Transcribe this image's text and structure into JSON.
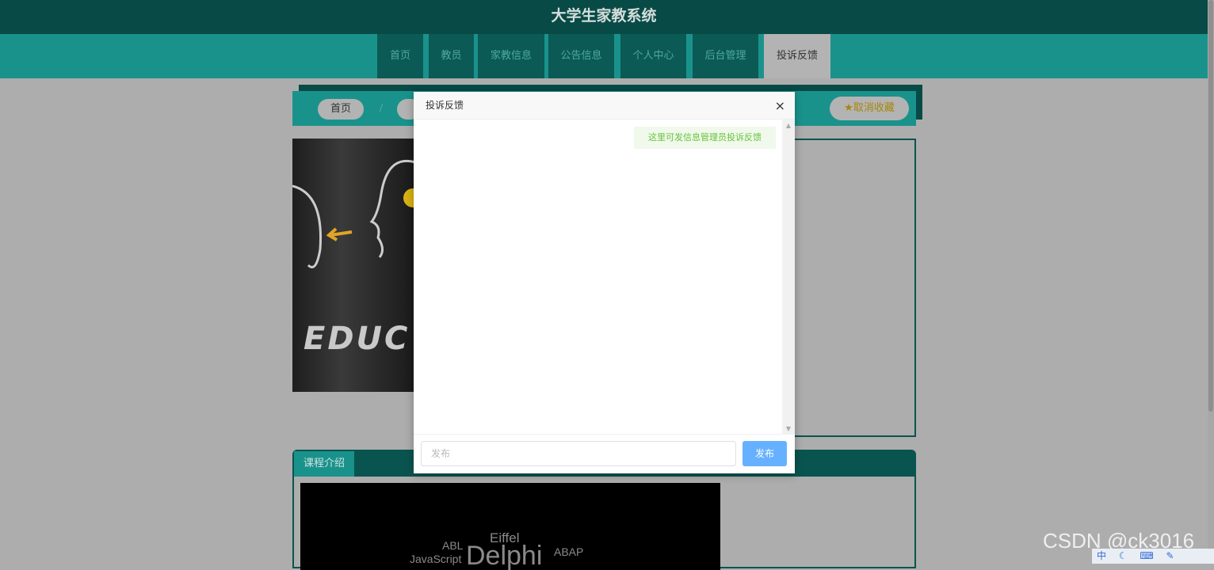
{
  "header": {
    "title": "大学生家教系统"
  },
  "nav": {
    "tabs": [
      {
        "label": "首页",
        "active": false
      },
      {
        "label": "教员",
        "active": false
      },
      {
        "label": "家教信息",
        "active": false
      },
      {
        "label": "公告信息",
        "active": false
      },
      {
        "label": "个人中心",
        "active": false
      },
      {
        "label": "后台管理",
        "active": false
      },
      {
        "label": "投诉反馈",
        "active": true
      }
    ]
  },
  "breadcrumb": {
    "home": "首页",
    "separator": "/",
    "favorite_label": "取消收藏"
  },
  "content": {
    "image_text": "EDUC",
    "course_tab": "课程介绍",
    "video_words": [
      "Eiffel",
      "ABL",
      "Delphi",
      "ABAP",
      "JavaScript"
    ]
  },
  "modal": {
    "title": "投诉反馈",
    "close": "×",
    "message": "这里可发信息管理员投诉反馈",
    "input_placeholder": "发布",
    "send_label": "发布"
  },
  "watermark": "CSDN @ck3016",
  "ime": "中"
}
